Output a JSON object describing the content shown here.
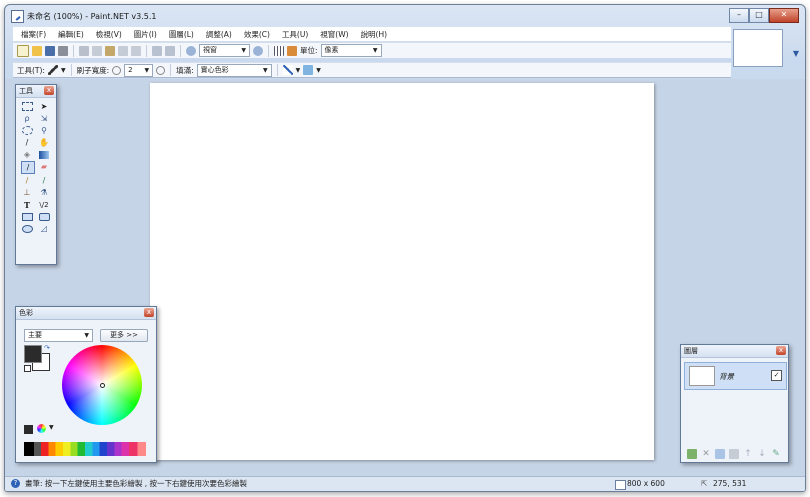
{
  "window": {
    "title": "未命名 (100%) - Paint.NET v3.5.1",
    "caption_buttons": [
      "–",
      "□",
      "✕"
    ]
  },
  "menu": [
    "檔案(F)",
    "編輯(E)",
    "檢視(V)",
    "圖片(I)",
    "圖層(L)",
    "調整(A)",
    "效果(C)",
    "工具(U)",
    "視窗(W)",
    "說明(H)"
  ],
  "toolbar1": {
    "zoom_value": "視窗",
    "units_label": "單位:",
    "units_value": "像素"
  },
  "toolbar2": {
    "tool_label": "工具(T):",
    "brush_width_label": "刷子寬度:",
    "brush_width_value": "2",
    "fill_label": "填滿:",
    "fill_value": "實心色彩"
  },
  "tools_panel": {
    "title": "工具",
    "tools": [
      "rectangle-select",
      "move-selection",
      "lasso-select",
      "move-selection-outline",
      "ellipse-select",
      "zoom",
      "magic-wand",
      "pan",
      "paint-bucket",
      "gradient",
      "paintbrush",
      "eraser",
      "pencil",
      "color-picker",
      "clone-stamp",
      "recolor",
      "text",
      "line-curve",
      "rectangle",
      "rounded-rectangle",
      "ellipse",
      "freeform-shape"
    ],
    "selected": "paintbrush",
    "text_glyph": "T",
    "line_glyph": "\\/2"
  },
  "colors_panel": {
    "title": "色彩",
    "mode_value": "主要",
    "more_button": "更多 >>",
    "primary_color": "#2b2b2b",
    "secondary_color": "#ffffff"
  },
  "layers_panel": {
    "title": "圖層",
    "layer_name": "背景",
    "layer_visible_check": "✓"
  },
  "status": {
    "hint": "畫筆: 按一下左鍵使用主要色彩繪製 , 按一下右鍵使用次要色彩繪製",
    "image_size": "800 x 600",
    "cursor_pos": "275, 531"
  },
  "colors": {
    "accent": "#2f63b6",
    "workspace": "#c6d4e7"
  }
}
